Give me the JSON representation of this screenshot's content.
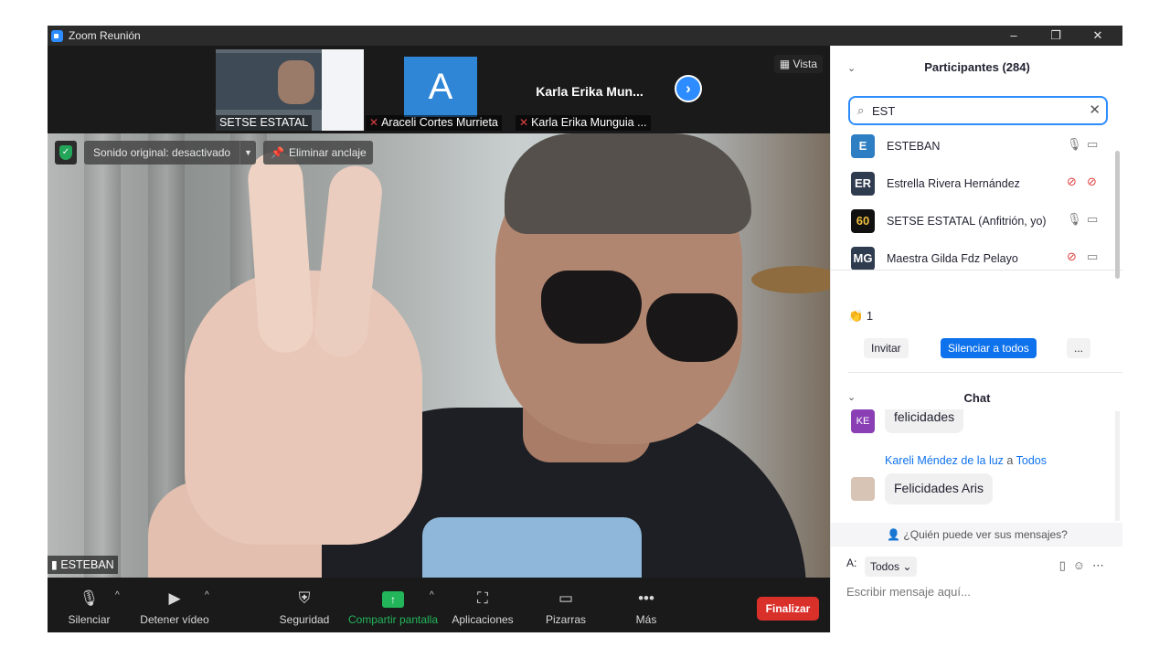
{
  "window": {
    "title": "Zoom Reunión",
    "minimize": "–",
    "restore": "❐",
    "close": "✕"
  },
  "gallery": {
    "thumbs": [
      {
        "name": "SETSE ESTATAL"
      },
      {
        "name": "Araceli Cortes Murrieta",
        "avatar_letter": "A"
      },
      {
        "name": "Karla Erika Munguia ...",
        "big_name": "Karla Erika Mun..."
      }
    ],
    "next_icon": "chevron-right-icon",
    "view_label": "Vista"
  },
  "video_overlay": {
    "sound_label": "Sonido original: desactivado",
    "unpin_label": "Eliminar anclaje",
    "speaker_name": "ESTEBAN"
  },
  "toolbar": {
    "mute_label": "Silenciar",
    "video_label": "Detener vídeo",
    "security_label": "Seguridad",
    "share_label": "Compartir pantalla",
    "apps_label": "Aplicaciones",
    "whiteboards_label": "Pizarras",
    "more_label": "Más",
    "end_label": "Finalizar"
  },
  "participants": {
    "header": "Participantes (284)",
    "search_value": "EST",
    "list": [
      {
        "initials": "E",
        "name": "ESTEBAN",
        "color": "#2e7ec4",
        "muted": false,
        "video_off": false
      },
      {
        "initials": "ER",
        "name": "Estrella Rivera Hernández",
        "color": "#2f3b4f",
        "muted": true,
        "video_off": true
      },
      {
        "initials": "60",
        "name": "SETSE ESTATAL (Anfitrión, yo)",
        "color": "#111111",
        "muted": false,
        "video_off": false
      },
      {
        "initials": "MG",
        "name": "Maestra Gilda Fdz Pelayo",
        "color": "#2f3b4f",
        "muted": true,
        "video_off": false
      }
    ],
    "reaction_count": "1",
    "invite_label": "Invitar",
    "mute_all_label": "Silenciar a todos",
    "more_label": "..."
  },
  "chat": {
    "header": "Chat",
    "messages": [
      {
        "initials": "KE",
        "text": "felicidades"
      },
      {
        "sender": "Kareli Méndez de la luz",
        "to_word": "a",
        "recipient": "Todos",
        "text": "Felicidades Aris"
      }
    ],
    "who_can_see": "¿Quién puede ver sus mensajes?",
    "to_label": "A:",
    "to_value": "Todos",
    "input_placeholder": "Escribir mensaje aquí..."
  },
  "colors": {
    "accent": "#2d8cff",
    "end_button": "#d9302a",
    "share_green": "#23b55a",
    "muted_red": "#e04040"
  }
}
